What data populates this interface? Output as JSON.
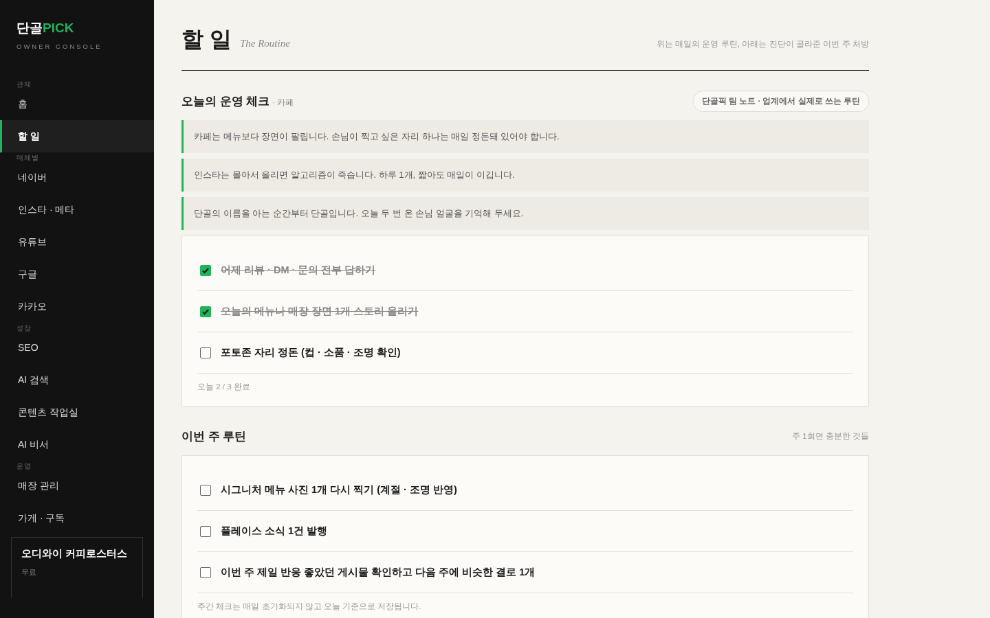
{
  "sidebar": {
    "logo": {
      "main": "단골",
      "accent": "PICK"
    },
    "subtitle": "OWNER CONSOLE",
    "groups": [
      {
        "label": "관제",
        "items": [
          {
            "label": "홈",
            "selected": false
          },
          {
            "label": "할 일",
            "selected": true
          }
        ]
      },
      {
        "label": "매체별",
        "items": [
          {
            "label": "네이버",
            "selected": false
          },
          {
            "label": "인스타 · 메타",
            "selected": false
          },
          {
            "label": "유튜브",
            "selected": false
          },
          {
            "label": "구글",
            "selected": false
          },
          {
            "label": "카카오",
            "selected": false
          }
        ]
      },
      {
        "label": "성장",
        "items": [
          {
            "label": "SEO",
            "selected": false
          },
          {
            "label": "AI 검색",
            "selected": false
          },
          {
            "label": "콘텐츠 작업실",
            "selected": false
          },
          {
            "label": "AI 비서",
            "selected": false
          }
        ]
      },
      {
        "label": "운영",
        "items": [
          {
            "label": "매장 관리",
            "selected": false
          },
          {
            "label": "가게 · 구독",
            "selected": false
          }
        ]
      }
    ],
    "store": {
      "name": "오디와이 커피로스터스",
      "plan": "무료"
    }
  },
  "header": {
    "title": "할 일",
    "subtitle": "The Routine",
    "note": "위는 매일의 운영 루틴, 아래는 진단이 골라준 이번 주 처방"
  },
  "today": {
    "title": "오늘의 운영 체크",
    "category": "· 카페",
    "tag": "단골픽 팀 노트 · 업계에서 실제로 쓰는 루틴",
    "tips": [
      "카페는 메뉴보다 장면이 팔립니다. 손님이 찍고 싶은 자리 하나는 매일 정돈돼 있어야 합니다.",
      "인스타는 몰아서 올리면 알고리즘이 죽습니다. 하루 1개, 짧아도 매일이 이깁니다.",
      "단골의 이름을 아는 순간부터 단골입니다. 오늘 두 번 온 손님 얼굴을 기억해 두세요."
    ],
    "tasks": [
      {
        "label": "어제 리뷰 · DM · 문의 전부 답하기",
        "checked": true
      },
      {
        "label": "오늘의 메뉴나 매장 장면 1개 스토리 올리기",
        "checked": true
      },
      {
        "label": "포토존 자리 정돈 (컵 · 소품 · 조명 확인)",
        "checked": false
      }
    ],
    "footer": "오늘 2 / 3 완료"
  },
  "weekly": {
    "title": "이번 주 루틴",
    "note": "주 1회면 충분한 것들",
    "tasks": [
      {
        "label": "시그니처 메뉴 사진 1개 다시 찍기 (계절 · 조명 반영)",
        "checked": false
      },
      {
        "label": "플레이스 소식 1건 발행",
        "checked": false
      },
      {
        "label": "이번 주 제일 반응 좋았던 게시물 확인하고 다음 주에 비슷한 결로 1개",
        "checked": false
      }
    ],
    "footer": "주간 체크는 매일 초기화되지 않고 오늘 기준으로 저장됩니다."
  }
}
